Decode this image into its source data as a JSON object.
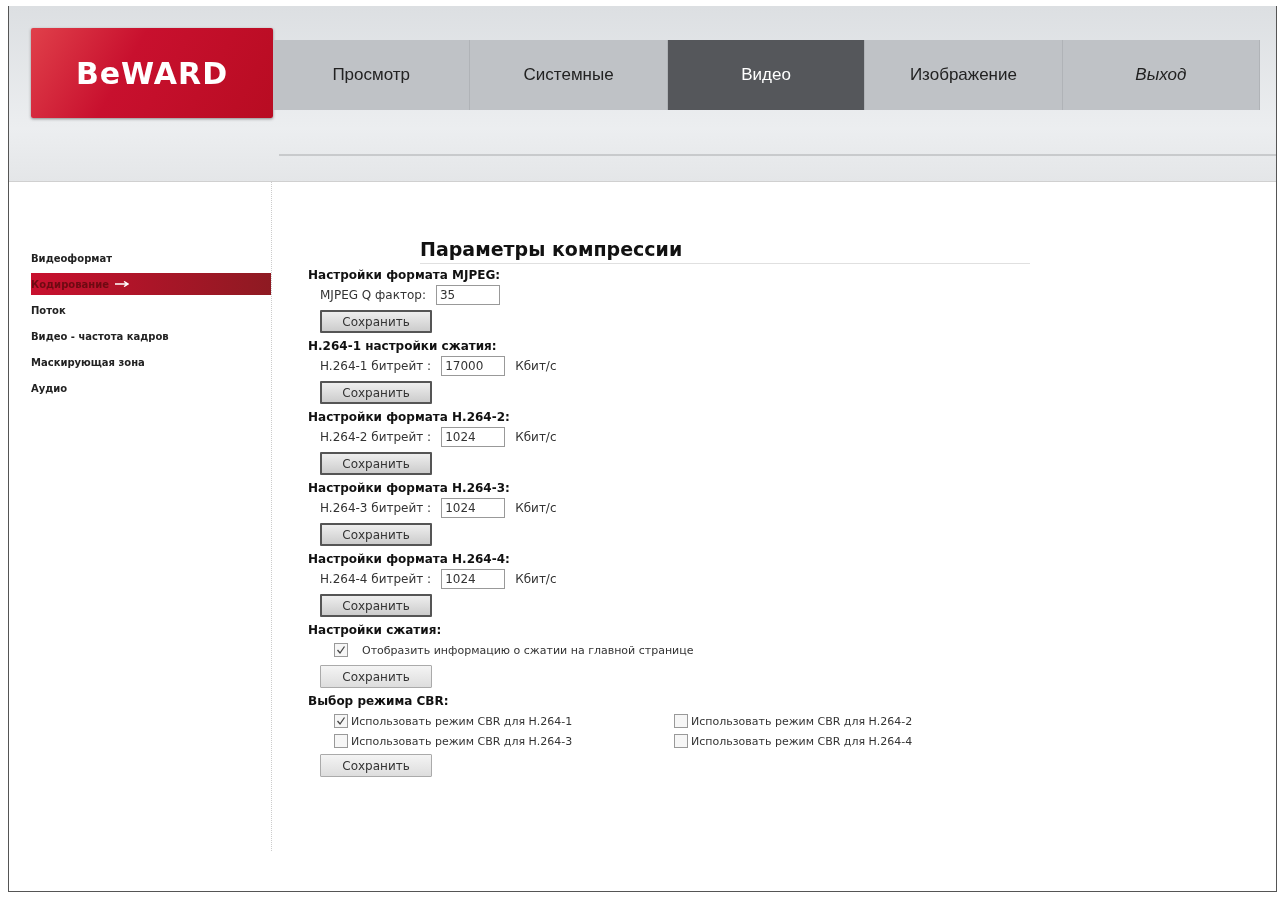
{
  "header": {
    "logo": "BeWARD",
    "tabs": [
      {
        "label": "Просмотр",
        "selected": false,
        "kind": "page"
      },
      {
        "label": "Системные",
        "selected": false,
        "kind": "page"
      },
      {
        "label": "Видео",
        "selected": true,
        "kind": "page"
      },
      {
        "label": "Изображение",
        "selected": false,
        "kind": "page"
      },
      {
        "label": "Выход",
        "selected": false,
        "kind": "logout"
      }
    ]
  },
  "sidebar": {
    "items": [
      {
        "label": "Видеоформат",
        "selected": false
      },
      {
        "label": "Кодирование",
        "selected": true
      },
      {
        "label": "Поток",
        "selected": false
      },
      {
        "label": "Видео - частота кадров",
        "selected": false
      },
      {
        "label": "Маскирующая зона",
        "selected": false
      },
      {
        "label": "Аудио",
        "selected": false
      }
    ]
  },
  "content": {
    "title": "Параметры компрессии",
    "sections": [
      {
        "kind": "input",
        "heading": "Настройки формата MJPEG:",
        "label": "MJPEG Q фактор:",
        "value": "35",
        "button": "Сохранить"
      },
      {
        "kind": "input",
        "heading": "H.264-1 настройки сжатия:",
        "label": "H.264-1 битрейт :",
        "value": "17000",
        "unit": "Кбит/с",
        "button": "Сохранить"
      },
      {
        "kind": "input",
        "heading": "Настройки формата H.264-2:",
        "label": "H.264-2 битрейт :",
        "value": "1024",
        "unit": "Кбит/с",
        "button": "Сохранить"
      },
      {
        "kind": "input",
        "heading": "Настройки формата H.264-3:",
        "label": "H.264-3 битрейт :",
        "value": "1024",
        "unit": "Кбит/с",
        "button": "Сохранить"
      },
      {
        "kind": "input",
        "heading": "Настройки формата H.264-4:",
        "label": "H.264-4 битрейт :",
        "value": "1024",
        "unit": "Кбит/с",
        "button": "Сохранить"
      },
      {
        "kind": "checkbox",
        "heading": "Настройки сжатия:",
        "options": [
          {
            "label": "Отобразить информацию о сжатии на главной странице",
            "checked": true
          }
        ],
        "button": "Сохранить"
      },
      {
        "kind": "grid",
        "heading": "Выбор режима CBR:",
        "options": [
          {
            "label": "Использовать режим CBR для H.264-1",
            "checked": true
          },
          {
            "label": "Использовать режим CBR для H.264-2",
            "checked": false
          },
          {
            "label": "Использовать режим CBR для H.264-3",
            "checked": false
          },
          {
            "label": "Использовать режим CBR для H.264-4",
            "checked": false
          }
        ],
        "button": "Сохранить"
      }
    ]
  }
}
